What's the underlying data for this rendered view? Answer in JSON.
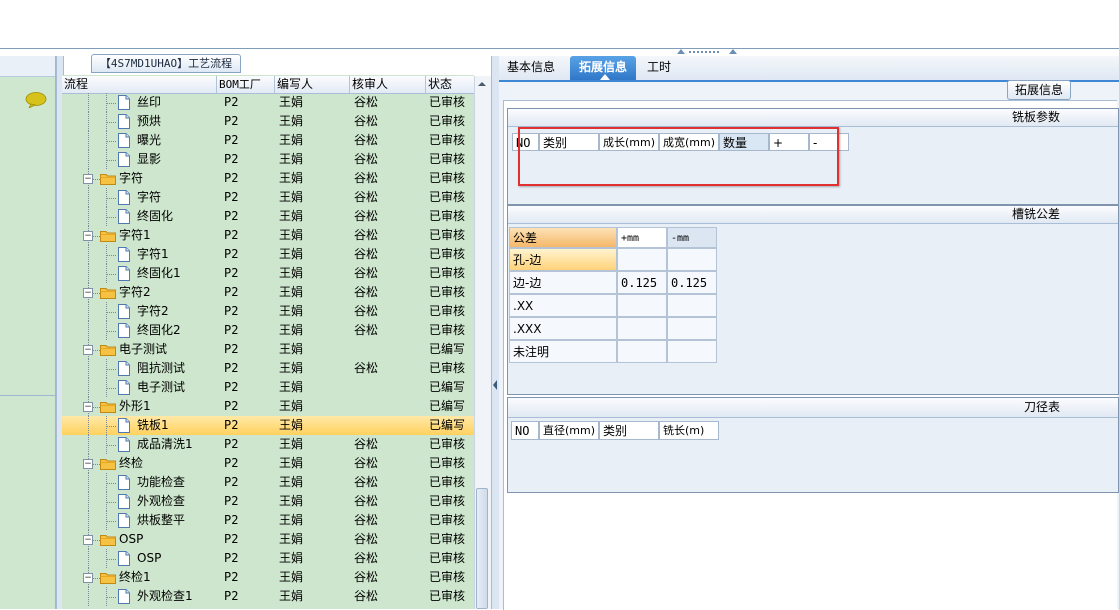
{
  "tree_panel": {
    "title": "【4S7MD1UHAO】工艺流程",
    "columns": [
      "流程",
      "BOM工厂",
      "编写人",
      "核审人",
      "状态"
    ],
    "rows": [
      {
        "name": "丝印",
        "level": 2,
        "type": "doc",
        "bom": "P2",
        "author": "王娟",
        "reviewer": "谷松",
        "status": "已审核"
      },
      {
        "name": "预烘",
        "level": 2,
        "type": "doc",
        "bom": "P2",
        "author": "王娟",
        "reviewer": "谷松",
        "status": "已审核"
      },
      {
        "name": "曝光",
        "level": 2,
        "type": "doc",
        "bom": "P2",
        "author": "王娟",
        "reviewer": "谷松",
        "status": "已审核"
      },
      {
        "name": "显影",
        "level": 2,
        "type": "doc",
        "bom": "P2",
        "author": "王娟",
        "reviewer": "谷松",
        "status": "已审核"
      },
      {
        "name": "字符",
        "level": 1,
        "type": "folder",
        "bom": "P2",
        "author": "王娟",
        "reviewer": "谷松",
        "status": "已审核"
      },
      {
        "name": "字符",
        "level": 2,
        "type": "doc",
        "bom": "P2",
        "author": "王娟",
        "reviewer": "谷松",
        "status": "已审核"
      },
      {
        "name": "终固化",
        "level": 2,
        "type": "doc",
        "bom": "P2",
        "author": "王娟",
        "reviewer": "谷松",
        "status": "已审核"
      },
      {
        "name": "字符1",
        "level": 1,
        "type": "folder",
        "bom": "P2",
        "author": "王娟",
        "reviewer": "谷松",
        "status": "已审核"
      },
      {
        "name": "字符1",
        "level": 2,
        "type": "doc",
        "bom": "P2",
        "author": "王娟",
        "reviewer": "谷松",
        "status": "已审核"
      },
      {
        "name": "终固化1",
        "level": 2,
        "type": "doc",
        "bom": "P2",
        "author": "王娟",
        "reviewer": "谷松",
        "status": "已审核"
      },
      {
        "name": "字符2",
        "level": 1,
        "type": "folder",
        "bom": "P2",
        "author": "王娟",
        "reviewer": "谷松",
        "status": "已审核"
      },
      {
        "name": "字符2",
        "level": 2,
        "type": "doc",
        "bom": "P2",
        "author": "王娟",
        "reviewer": "谷松",
        "status": "已审核"
      },
      {
        "name": "终固化2",
        "level": 2,
        "type": "doc",
        "bom": "P2",
        "author": "王娟",
        "reviewer": "谷松",
        "status": "已审核"
      },
      {
        "name": "电子测试",
        "level": 1,
        "type": "folder",
        "bom": "P2",
        "author": "王娟",
        "reviewer": "",
        "status": "已编写"
      },
      {
        "name": "阻抗测试",
        "level": 2,
        "type": "doc",
        "bom": "P2",
        "author": "王娟",
        "reviewer": "谷松",
        "status": "已审核"
      },
      {
        "name": "电子测试",
        "level": 2,
        "type": "doc",
        "bom": "P2",
        "author": "王娟",
        "reviewer": "",
        "status": "已编写"
      },
      {
        "name": "外形1",
        "level": 1,
        "type": "folder",
        "bom": "P2",
        "author": "王娟",
        "reviewer": "",
        "status": "已编写"
      },
      {
        "name": "铣板1",
        "level": 2,
        "type": "doc",
        "bom": "P2",
        "author": "王娟",
        "reviewer": "",
        "status": "已编写",
        "selected": true
      },
      {
        "name": "成品清洗1",
        "level": 2,
        "type": "doc",
        "bom": "P2",
        "author": "王娟",
        "reviewer": "谷松",
        "status": "已审核"
      },
      {
        "name": "终检",
        "level": 1,
        "type": "folder",
        "bom": "P2",
        "author": "王娟",
        "reviewer": "谷松",
        "status": "已审核"
      },
      {
        "name": "功能检查",
        "level": 2,
        "type": "doc",
        "bom": "P2",
        "author": "王娟",
        "reviewer": "谷松",
        "status": "已审核"
      },
      {
        "name": "外观检查",
        "level": 2,
        "type": "doc",
        "bom": "P2",
        "author": "王娟",
        "reviewer": "谷松",
        "status": "已审核"
      },
      {
        "name": "烘板整平",
        "level": 2,
        "type": "doc",
        "bom": "P2",
        "author": "王娟",
        "reviewer": "谷松",
        "status": "已审核"
      },
      {
        "name": "OSP",
        "level": 1,
        "type": "folder",
        "bom": "P2",
        "author": "王娟",
        "reviewer": "谷松",
        "status": "已审核"
      },
      {
        "name": "OSP",
        "level": 2,
        "type": "doc",
        "bom": "P2",
        "author": "王娟",
        "reviewer": "谷松",
        "status": "已审核"
      },
      {
        "name": "终检1",
        "level": 1,
        "type": "folder",
        "bom": "P2",
        "author": "王娟",
        "reviewer": "谷松",
        "status": "已审核"
      },
      {
        "name": "外观检查1",
        "level": 2,
        "type": "doc",
        "bom": "P2",
        "author": "王娟",
        "reviewer": "谷松",
        "status": "已审核"
      }
    ]
  },
  "tabs": {
    "basic": "基本信息",
    "extended": "拓展信息",
    "hours": "工时",
    "active": "extended"
  },
  "ext_button": "拓展信息",
  "milling_params": {
    "title": "铣板参数",
    "columns": [
      "NO",
      "类别",
      "成长(mm)",
      "成宽(mm)",
      "数量",
      "+",
      "-"
    ]
  },
  "slot_tolerance": {
    "title": "槽铣公差",
    "columns": [
      "公差",
      "+mm",
      "-mm"
    ],
    "rows": [
      {
        "label": "孔-边",
        "plus": "",
        "minus": "",
        "highlight": true
      },
      {
        "label": "边-边",
        "plus": "0.125",
        "minus": "0.125"
      },
      {
        "label": ".XX",
        "plus": "",
        "minus": ""
      },
      {
        "label": ".XXX",
        "plus": "",
        "minus": ""
      },
      {
        "label": "未注明",
        "plus": "",
        "minus": ""
      }
    ]
  },
  "tool_table": {
    "title": "刀径表",
    "columns": [
      "NO",
      "直径(mm)",
      "类别",
      "铣长(m)"
    ]
  },
  "colors": {
    "grid_green": "#cde6cd",
    "selection": "#ffd15e",
    "tab_active": "#3d87d4",
    "highlight_box": "#e03030"
  }
}
